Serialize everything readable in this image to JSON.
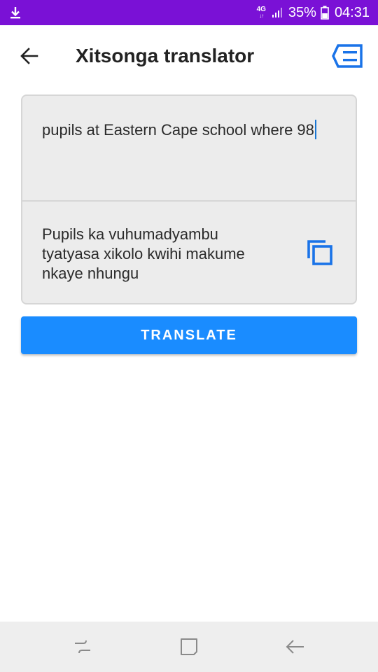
{
  "status_bar": {
    "network": "4G",
    "battery_percent": "35%",
    "time": "04:31",
    "icons": [
      "download-icon",
      "signal-icon",
      "battery-icon"
    ]
  },
  "app_bar": {
    "title": "Xitsonga translator",
    "icons": [
      "back-arrow-icon",
      "feedback-icon"
    ]
  },
  "translator": {
    "input_text": "pupils at Eastern Cape school where 98",
    "output_text": "Pupils ka vuhumadyambu tyatyasa xikolo kwihi makume nkaye nhungu",
    "copy_icon": "copy-icon",
    "translate_label": "TRANSLATE"
  },
  "nav_bar": {
    "icons": [
      "recent-apps-icon",
      "home-icon",
      "back-icon"
    ]
  },
  "colors": {
    "status_bar": "#7a11d6",
    "accent": "#1a8cff",
    "card_bg": "#ececec",
    "nav_bg": "#eeeeee"
  }
}
